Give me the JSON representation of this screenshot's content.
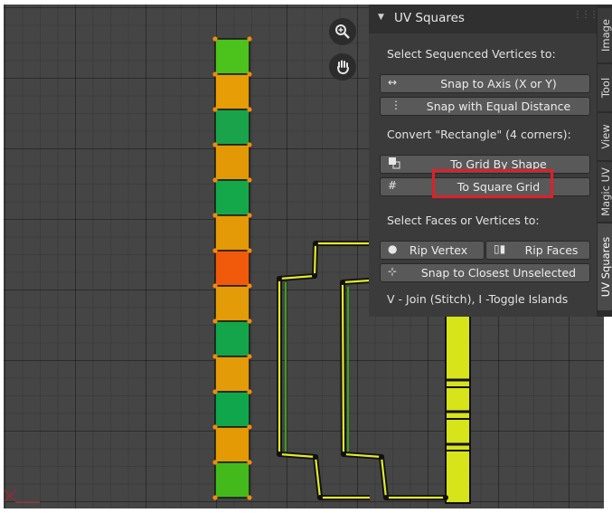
{
  "panel": {
    "title": "UV Squares",
    "section1_label": "Select Sequenced Vertices to:",
    "snap_axis": "Snap to Axis (X or Y)",
    "snap_equal": "Snap with Equal Distance",
    "section2_label": "Convert \"Rectangle\" (4 corners):",
    "grid_by_shape": "To Grid By Shape",
    "square_grid": "To Square Grid",
    "section3_label": "Select Faces or Vertices to:",
    "rip_vertex": "Rip Vertex",
    "rip_faces": "Rip Faces",
    "snap_closest": "Snap to Closest Unselected",
    "hint": "V - Join (Stitch), I -Toggle Islands"
  },
  "tabs": [
    "Image",
    "Tool",
    "View",
    "Magic UV",
    "UV Squares"
  ],
  "active_tab": "UV Squares",
  "icons": {
    "zoom": "zoom-in-icon",
    "pan": "hand-pan-icon",
    "axis": "left-right-arrow-icon",
    "equal": "vertical-dots-icon",
    "shape": "grid-shape-icon",
    "grid": "hash-grid-icon",
    "rip_vertex": "dot-icon",
    "rip_faces": "faces-icon",
    "snap_closest": "snap-icon"
  },
  "uv_squares_column": {
    "colors": [
      "#4cc21c",
      "#e79d05",
      "#1aa34a",
      "#e39906",
      "#14a84a",
      "#e39a06",
      "#f05a0a",
      "#e49b08",
      "#14a54b",
      "#e49b08",
      "#10a64c",
      "#e39a05",
      "#44b91c"
    ]
  },
  "colors": {
    "background": "#454545",
    "panel": "#303030",
    "button": "#595959",
    "highlight": "#e0202a",
    "selected_edge": "#d7e41a",
    "vertex": "#f28a0f"
  }
}
